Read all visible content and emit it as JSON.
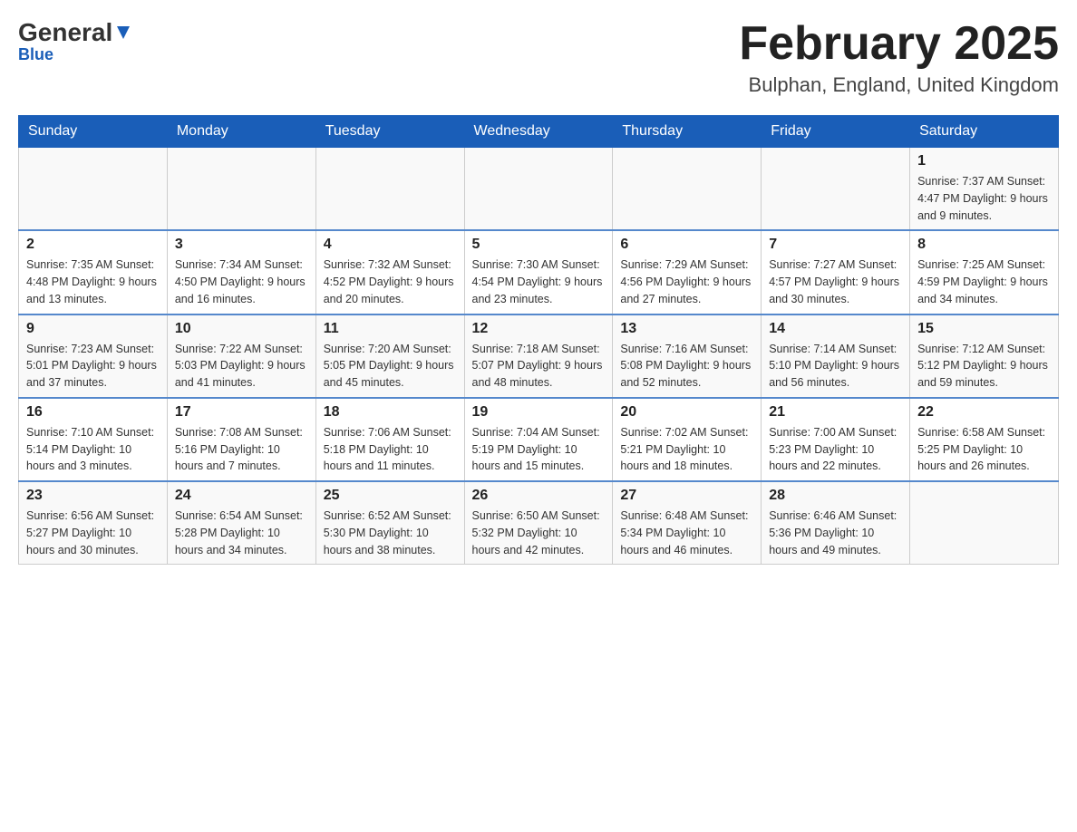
{
  "header": {
    "logo_general": "General",
    "logo_blue": "Blue",
    "main_title": "February 2025",
    "subtitle": "Bulphan, England, United Kingdom"
  },
  "days_of_week": [
    "Sunday",
    "Monday",
    "Tuesday",
    "Wednesday",
    "Thursday",
    "Friday",
    "Saturday"
  ],
  "weeks": [
    [
      {
        "date": "",
        "info": ""
      },
      {
        "date": "",
        "info": ""
      },
      {
        "date": "",
        "info": ""
      },
      {
        "date": "",
        "info": ""
      },
      {
        "date": "",
        "info": ""
      },
      {
        "date": "",
        "info": ""
      },
      {
        "date": "1",
        "info": "Sunrise: 7:37 AM\nSunset: 4:47 PM\nDaylight: 9 hours and 9 minutes."
      }
    ],
    [
      {
        "date": "2",
        "info": "Sunrise: 7:35 AM\nSunset: 4:48 PM\nDaylight: 9 hours and 13 minutes."
      },
      {
        "date": "3",
        "info": "Sunrise: 7:34 AM\nSunset: 4:50 PM\nDaylight: 9 hours and 16 minutes."
      },
      {
        "date": "4",
        "info": "Sunrise: 7:32 AM\nSunset: 4:52 PM\nDaylight: 9 hours and 20 minutes."
      },
      {
        "date": "5",
        "info": "Sunrise: 7:30 AM\nSunset: 4:54 PM\nDaylight: 9 hours and 23 minutes."
      },
      {
        "date": "6",
        "info": "Sunrise: 7:29 AM\nSunset: 4:56 PM\nDaylight: 9 hours and 27 minutes."
      },
      {
        "date": "7",
        "info": "Sunrise: 7:27 AM\nSunset: 4:57 PM\nDaylight: 9 hours and 30 minutes."
      },
      {
        "date": "8",
        "info": "Sunrise: 7:25 AM\nSunset: 4:59 PM\nDaylight: 9 hours and 34 minutes."
      }
    ],
    [
      {
        "date": "9",
        "info": "Sunrise: 7:23 AM\nSunset: 5:01 PM\nDaylight: 9 hours and 37 minutes."
      },
      {
        "date": "10",
        "info": "Sunrise: 7:22 AM\nSunset: 5:03 PM\nDaylight: 9 hours and 41 minutes."
      },
      {
        "date": "11",
        "info": "Sunrise: 7:20 AM\nSunset: 5:05 PM\nDaylight: 9 hours and 45 minutes."
      },
      {
        "date": "12",
        "info": "Sunrise: 7:18 AM\nSunset: 5:07 PM\nDaylight: 9 hours and 48 minutes."
      },
      {
        "date": "13",
        "info": "Sunrise: 7:16 AM\nSunset: 5:08 PM\nDaylight: 9 hours and 52 minutes."
      },
      {
        "date": "14",
        "info": "Sunrise: 7:14 AM\nSunset: 5:10 PM\nDaylight: 9 hours and 56 minutes."
      },
      {
        "date": "15",
        "info": "Sunrise: 7:12 AM\nSunset: 5:12 PM\nDaylight: 9 hours and 59 minutes."
      }
    ],
    [
      {
        "date": "16",
        "info": "Sunrise: 7:10 AM\nSunset: 5:14 PM\nDaylight: 10 hours and 3 minutes."
      },
      {
        "date": "17",
        "info": "Sunrise: 7:08 AM\nSunset: 5:16 PM\nDaylight: 10 hours and 7 minutes."
      },
      {
        "date": "18",
        "info": "Sunrise: 7:06 AM\nSunset: 5:18 PM\nDaylight: 10 hours and 11 minutes."
      },
      {
        "date": "19",
        "info": "Sunrise: 7:04 AM\nSunset: 5:19 PM\nDaylight: 10 hours and 15 minutes."
      },
      {
        "date": "20",
        "info": "Sunrise: 7:02 AM\nSunset: 5:21 PM\nDaylight: 10 hours and 18 minutes."
      },
      {
        "date": "21",
        "info": "Sunrise: 7:00 AM\nSunset: 5:23 PM\nDaylight: 10 hours and 22 minutes."
      },
      {
        "date": "22",
        "info": "Sunrise: 6:58 AM\nSunset: 5:25 PM\nDaylight: 10 hours and 26 minutes."
      }
    ],
    [
      {
        "date": "23",
        "info": "Sunrise: 6:56 AM\nSunset: 5:27 PM\nDaylight: 10 hours and 30 minutes."
      },
      {
        "date": "24",
        "info": "Sunrise: 6:54 AM\nSunset: 5:28 PM\nDaylight: 10 hours and 34 minutes."
      },
      {
        "date": "25",
        "info": "Sunrise: 6:52 AM\nSunset: 5:30 PM\nDaylight: 10 hours and 38 minutes."
      },
      {
        "date": "26",
        "info": "Sunrise: 6:50 AM\nSunset: 5:32 PM\nDaylight: 10 hours and 42 minutes."
      },
      {
        "date": "27",
        "info": "Sunrise: 6:48 AM\nSunset: 5:34 PM\nDaylight: 10 hours and 46 minutes."
      },
      {
        "date": "28",
        "info": "Sunrise: 6:46 AM\nSunset: 5:36 PM\nDaylight: 10 hours and 49 minutes."
      },
      {
        "date": "",
        "info": ""
      }
    ]
  ]
}
